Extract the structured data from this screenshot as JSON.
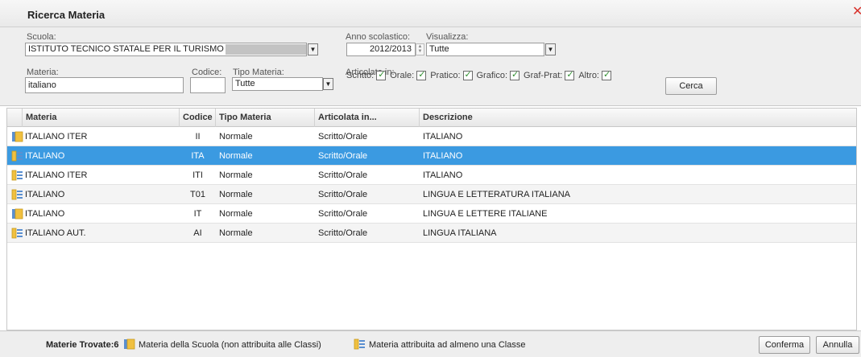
{
  "window": {
    "title": "Ricerca Materia",
    "close_icon": "close-x-icon",
    "close_glyph": "✕"
  },
  "filters": {
    "scuola": {
      "label": "Scuola:",
      "value": "ISTITUTO TECNICO STATALE PER IL TURISMO"
    },
    "anno": {
      "label": "Anno scolastico:",
      "value": "2012/2013"
    },
    "visualizza": {
      "label": "Visualizza:",
      "value": "Tutte"
    },
    "materia": {
      "label": "Materia:",
      "value": "italiano"
    },
    "codice": {
      "label": "Codice:",
      "value": ""
    },
    "tipo_materia": {
      "label": "Tipo Materia:",
      "value": "Tutte"
    },
    "articolata": {
      "label": "Articolata in:",
      "options": [
        {
          "label": "Scritto:",
          "checked": true
        },
        {
          "label": "Orale:",
          "checked": true
        },
        {
          "label": "Pratico:",
          "checked": true
        },
        {
          "label": "Grafico:",
          "checked": true
        },
        {
          "label": "Graf-Prat:",
          "checked": true
        },
        {
          "label": "Altro:",
          "checked": true
        }
      ]
    },
    "search_button": "Cerca"
  },
  "grid": {
    "columns": [
      "Materia",
      "Codice",
      "Tipo Materia",
      "Articolata in...",
      "Descrizione"
    ],
    "rows": [
      {
        "icon": "school-subject-icon",
        "materia": "ITALIANO ITER",
        "codice": "II",
        "tipo": "Normale",
        "articolata": "Scritto/Orale",
        "descrizione": "ITALIANO",
        "selected": false
      },
      {
        "icon": "class-subject-icon",
        "materia": "ITALIANO",
        "codice": "ITA",
        "tipo": "Normale",
        "articolata": "Scritto/Orale",
        "descrizione": "ITALIANO",
        "selected": true
      },
      {
        "icon": "class-subject-icon",
        "materia": "ITALIANO ITER",
        "codice": "ITI",
        "tipo": "Normale",
        "articolata": "Scritto/Orale",
        "descrizione": "ITALIANO",
        "selected": false
      },
      {
        "icon": "class-subject-icon",
        "materia": "ITALIANO",
        "codice": "T01",
        "tipo": "Normale",
        "articolata": "Scritto/Orale",
        "descrizione": "LINGUA E LETTERATURA ITALIANA",
        "selected": false
      },
      {
        "icon": "school-subject-icon",
        "materia": "ITALIANO",
        "codice": "IT",
        "tipo": "Normale",
        "articolata": "Scritto/Orale",
        "descrizione": "LINGUA E LETTERE ITALIANE",
        "selected": false
      },
      {
        "icon": "class-subject-icon",
        "materia": "ITALIANO AUT.",
        "codice": "AI",
        "tipo": "Normale",
        "articolata": "Scritto/Orale",
        "descrizione": "LINGUA ITALIANA",
        "selected": false
      }
    ]
  },
  "footer": {
    "count_text": "Materie Trovate:6",
    "legend_school": "Materia della Scuola (non attribuita alle Classi)",
    "legend_class": "Materia attribuita ad almeno una Classe",
    "confirm_button": "Conferma",
    "cancel_button": "Annulla"
  },
  "colors": {
    "selected_row": "#3b9ae1",
    "close": "#d8322c",
    "icon_fill": "#f0c040",
    "icon_grid": "#5a8fd0"
  }
}
